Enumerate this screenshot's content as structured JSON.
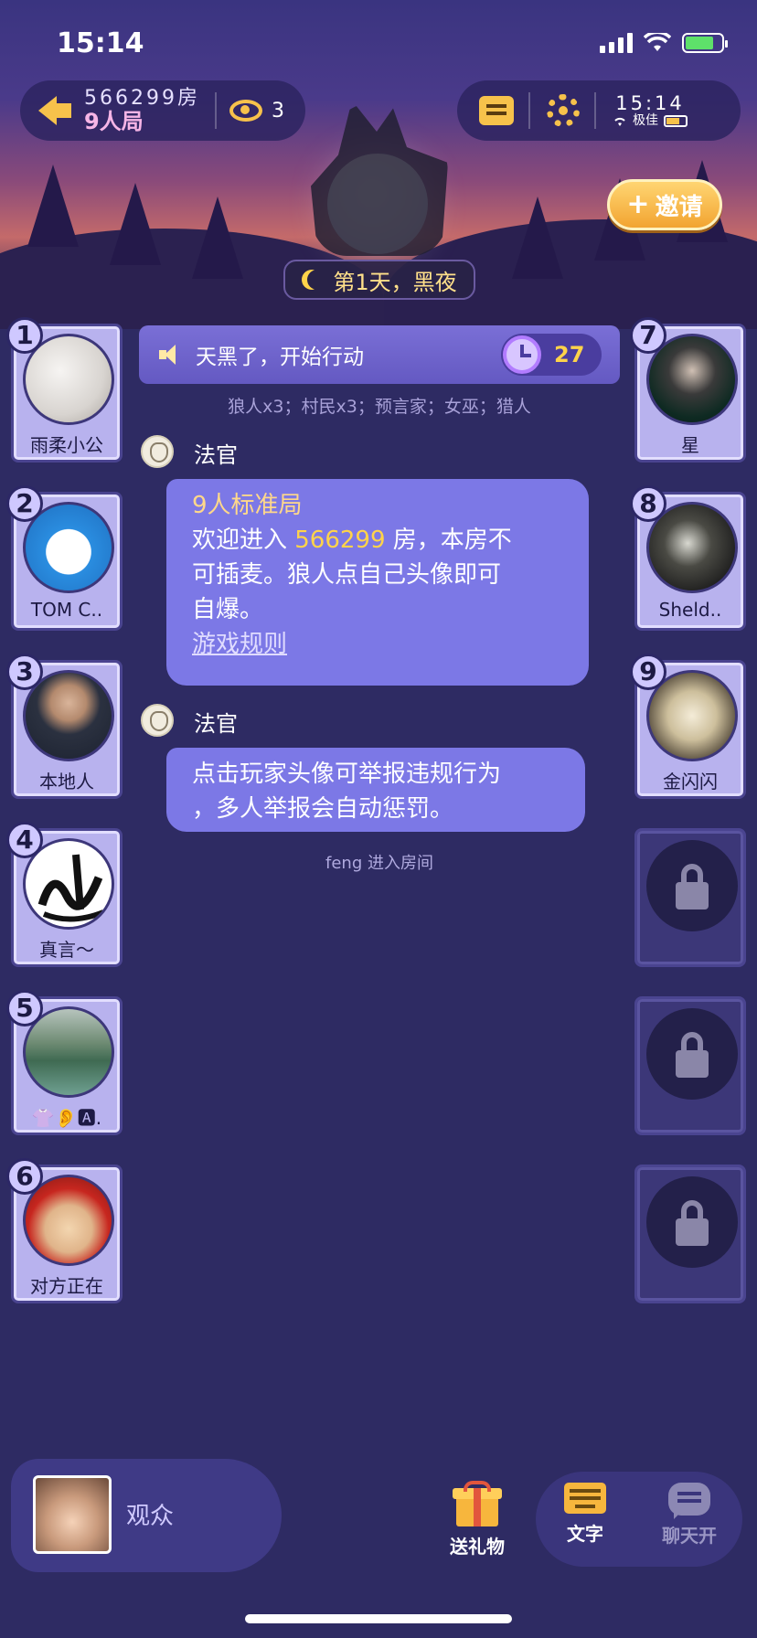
{
  "status_bar": {
    "time": "15:14"
  },
  "header": {
    "room_number": "566299房",
    "room_type": "9人局",
    "viewer_count": "3",
    "mini_time": "15:14",
    "network_label": "极佳",
    "invite_label": "邀请",
    "day_label": "第1天，黑夜"
  },
  "announcement": {
    "text": "天黑了，开始行动",
    "countdown": "27",
    "roles": "狼人x3；村民x3；预言家；女巫；猎人"
  },
  "seats_left": [
    {
      "number": "1",
      "name": "雨柔小公"
    },
    {
      "number": "2",
      "name": "TOM C.."
    },
    {
      "number": "3",
      "name": "本地人"
    },
    {
      "number": "4",
      "name": "真言～"
    },
    {
      "number": "5",
      "name": "👚👂🅰."
    },
    {
      "number": "6",
      "name": "对方正在"
    }
  ],
  "seats_right": [
    {
      "number": "7",
      "name": "星"
    },
    {
      "number": "8",
      "name": "Sheld.."
    },
    {
      "number": "9",
      "name": "金闪闪"
    }
  ],
  "chat": {
    "messages": [
      {
        "sender": "法官",
        "title": "9人标准局",
        "line1_pre": "欢迎进入 ",
        "line1_room": "566299",
        "line1_post": " 房，本房不",
        "line2": "可插麦。狼人点自己头像即可",
        "line3": "自爆。",
        "link": "游戏规则"
      },
      {
        "sender": "法官",
        "line1": "点击玩家头像可举报违规行为",
        "line2": "，多人举报会自动惩罚。"
      }
    ],
    "system_notice": "feng 进入房间"
  },
  "bottom_bar": {
    "audience_label": "观众",
    "gift_label": "送礼物",
    "text_label": "文字",
    "chat_toggle_label": "聊天开"
  },
  "colors": {
    "background": "#2e2b63",
    "accent_gold": "#f7c24b",
    "bubble": "#7c78e6",
    "seat": "#b8b2ee"
  }
}
